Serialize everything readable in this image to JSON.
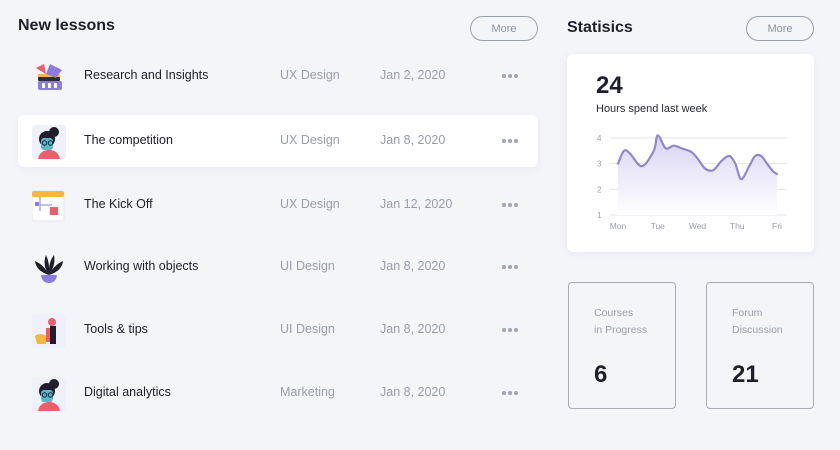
{
  "lessons": {
    "title": "New lessons",
    "more_label": "More",
    "items": [
      {
        "title": "Research and Insights",
        "category": "UX Design",
        "date": "Jan 2, 2020",
        "icon": "research-illustration-icon"
      },
      {
        "title": "The competition",
        "category": "UX Design",
        "date": "Jan 8, 2020",
        "icon": "person-avatar-icon"
      },
      {
        "title": "The Kick Off",
        "category": "UX Design",
        "date": "Jan 12, 2020",
        "icon": "flowchart-icon"
      },
      {
        "title": "Working with objects",
        "category": "UI Design",
        "date": "Jan 8, 2020",
        "icon": "plant-icon"
      },
      {
        "title": "Tools & tips",
        "category": "UI Design",
        "date": "Jan 8, 2020",
        "icon": "tools-illustration-icon"
      },
      {
        "title": "Digital analytics",
        "category": "Marketing",
        "date": "Jan 8, 2020",
        "icon": "person-avatar-icon"
      }
    ]
  },
  "stats": {
    "title": "Statisics",
    "more_label": "More",
    "hours_value": "24",
    "hours_label": "Hours spend last week",
    "courses": {
      "label_line1": "Courses",
      "label_line2": "in Progress",
      "value": "6"
    },
    "forum": {
      "label_line1": "Forum",
      "label_line2": "Discussion",
      "value": "21"
    }
  },
  "chart_data": {
    "type": "line",
    "x": [
      "Mon",
      "Tue",
      "Wed",
      "Thu",
      "Fri"
    ],
    "yticks": [
      "1",
      "2",
      "3",
      "4"
    ],
    "ylim": [
      1,
      4.2
    ],
    "series": [
      {
        "xpos": [
          0,
          0.15,
          0.3,
          0.6,
          0.9,
          1.0,
          1.2,
          1.4,
          1.6,
          1.85,
          2.0,
          2.2,
          2.4,
          2.6,
          2.8,
          2.95,
          3.1,
          3.3,
          3.45,
          3.6,
          3.75,
          3.9,
          4.0
        ],
        "values": [
          3.0,
          3.5,
          3.4,
          2.9,
          3.5,
          4.1,
          3.6,
          3.7,
          3.6,
          3.45,
          3.2,
          2.8,
          2.75,
          3.1,
          3.3,
          3.0,
          2.4,
          2.9,
          3.3,
          3.3,
          3.0,
          2.7,
          2.6
        ]
      }
    ],
    "colors": {
      "line": "#9386cf",
      "fill_top": "#d9d4f3",
      "fill_bottom": "#ffffff",
      "grid": "#e6e6ee"
    }
  }
}
